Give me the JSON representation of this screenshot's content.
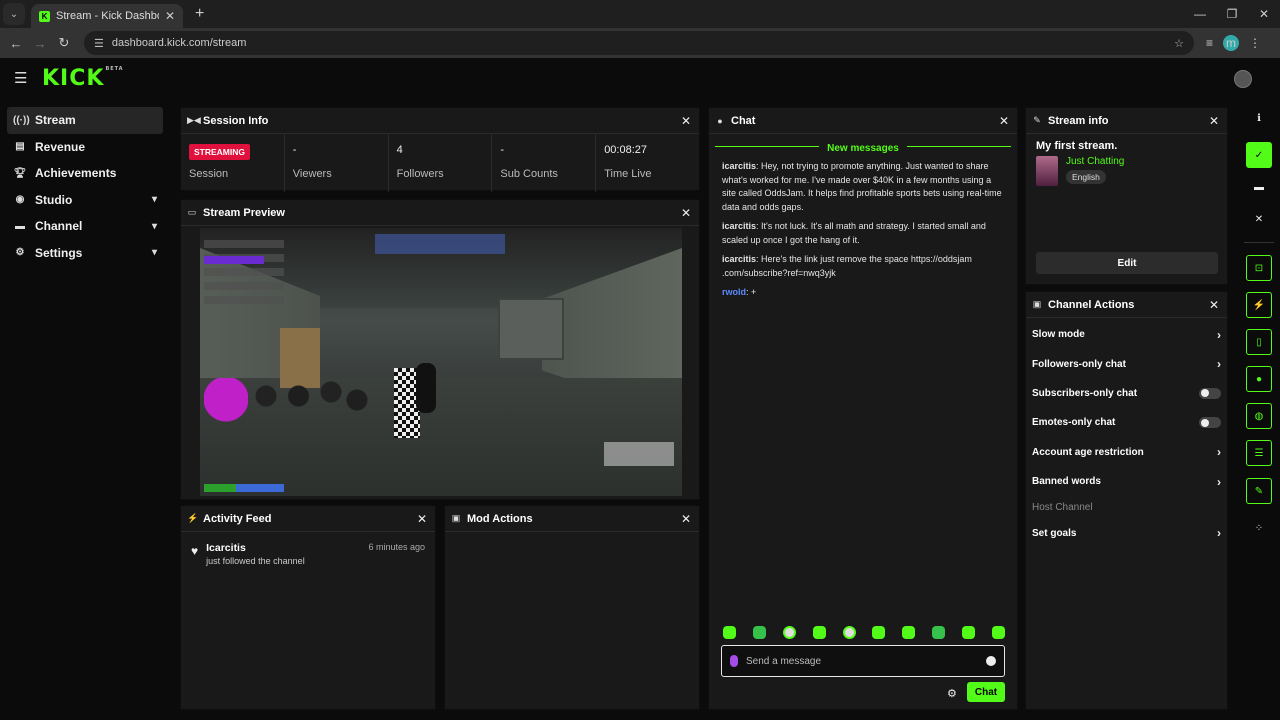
{
  "browser": {
    "tab_title": "Stream - Kick Dashboard",
    "url": "dashboard.kick.com/stream",
    "profile_initial": "m"
  },
  "app": {
    "logo": "KICK",
    "logo_badge": "BETA",
    "brand_color": "#53fc18"
  },
  "sidebar": {
    "items": [
      {
        "label": "Stream",
        "icon": "stream-icon"
      },
      {
        "label": "Revenue",
        "icon": "revenue-icon"
      },
      {
        "label": "Achievements",
        "icon": "trophy-icon"
      },
      {
        "label": "Studio",
        "icon": "studio-icon"
      },
      {
        "label": "Channel",
        "icon": "channel-icon"
      },
      {
        "label": "Settings",
        "icon": "gear-icon"
      }
    ]
  },
  "session_info": {
    "title": "Session Info",
    "status_badge": "STREAMING",
    "session_label": "Session",
    "viewers_value": "-",
    "viewers_label": "Viewers",
    "followers_value": "4",
    "followers_label": "Followers",
    "subs_value": "-",
    "subs_label": "Sub Counts",
    "time_value": "00:08:27",
    "time_label": "Time Live"
  },
  "stream_preview": {
    "title": "Stream Preview"
  },
  "activity_feed": {
    "title": "Activity Feed",
    "items": [
      {
        "user": "Icarcitis",
        "action": "just followed the channel",
        "time": "6 minutes ago"
      }
    ]
  },
  "mod_actions": {
    "title": "Mod Actions"
  },
  "chat": {
    "title": "Chat",
    "new_messages": "New messages",
    "messages": [
      {
        "user": "icarcitis",
        "text": " Hey, not trying to promote anything. Just wanted to share what's worked for me. I've made over $40K in a few months using a site called OddsJam. It helps find profitable sports bets using real-time data and odds gaps."
      },
      {
        "user": "icarcitis",
        "text": " It's not luck. It's all math and strategy. I started small and scaled up once I got the hang of it."
      },
      {
        "user": "icarcitis",
        "text": " Here's the link just remove the space https://oddsjam .com/subscribe?ref=nwq3yjk"
      },
      {
        "user": "rwold",
        "text": " +"
      }
    ],
    "input_placeholder": "Send a message",
    "send_label": "Chat"
  },
  "stream_info": {
    "title": "Stream info",
    "stream_title": "My first stream.",
    "category": "Just Chatting",
    "language": "English",
    "edit_label": "Edit"
  },
  "channel_actions": {
    "title": "Channel Actions",
    "items": [
      {
        "label": "Slow mode",
        "control": "chevron"
      },
      {
        "label": "Followers-only chat",
        "control": "chevron"
      },
      {
        "label": "Subscribers-only chat",
        "control": "toggle",
        "enabled": false
      },
      {
        "label": "Emotes-only chat",
        "control": "toggle",
        "enabled": false
      },
      {
        "label": "Account age restriction",
        "control": "chevron"
      },
      {
        "label": "Banned words",
        "control": "chevron"
      },
      {
        "label": "Host Channel",
        "control": "none"
      },
      {
        "label": "Set goals",
        "control": "chevron"
      }
    ]
  }
}
